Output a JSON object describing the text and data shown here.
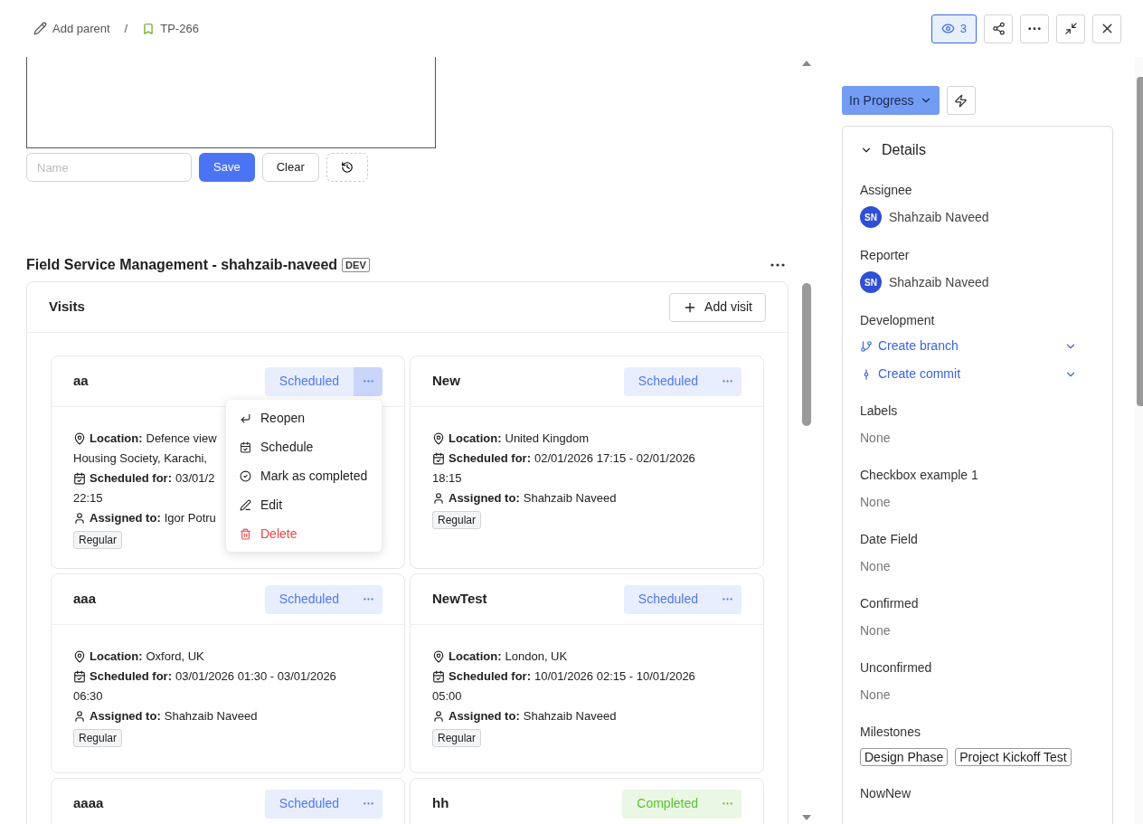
{
  "breadcrumb": {
    "parent_action": "Add parent",
    "separator": "/",
    "issue_key": "TP-266"
  },
  "header_actions": {
    "watchers": "3"
  },
  "editor": {
    "name_placeholder": "Name",
    "save": "Save",
    "clear": "Clear"
  },
  "section": {
    "title": "Field Service Management - shahzaib-naveed",
    "badge": "DEV"
  },
  "visits": {
    "title": "Visits",
    "add_button": "Add visit",
    "cards": [
      {
        "name": "aa",
        "status": "Scheduled",
        "color": "#4f78f0",
        "menu_open": true,
        "location_label": "Location:",
        "location": "Defence view",
        "location_cont": "Housing Society, Karachi,",
        "scheduled_label": "Scheduled for:",
        "scheduled": "03/01/2",
        "scheduled_cont": "22:15",
        "assigned_label": "Assigned to:",
        "assigned": "Igor Potru",
        "tag": "Regular"
      },
      {
        "name": "New",
        "status": "Scheduled",
        "color": "#4f78f0",
        "menu_open": false,
        "location_label": "Location:",
        "location": "United Kingdom",
        "scheduled_label": "Scheduled for:",
        "scheduled": "02/01/2026 17:15 - 02/01/2026",
        "scheduled_cont": "18:15",
        "assigned_label": "Assigned to:",
        "assigned": "Shahzaib Naveed",
        "tag": "Regular"
      },
      {
        "name": "aaa",
        "status": "Scheduled",
        "color": "#4f78f0",
        "menu_open": false,
        "location_label": "Location:",
        "location": "Oxford, UK",
        "scheduled_label": "Scheduled for:",
        "scheduled": "03/01/2026 01:30 - 03/01/2026",
        "scheduled_cont": "06:30",
        "assigned_label": "Assigned to:",
        "assigned": "Shahzaib Naveed",
        "tag": "Regular"
      },
      {
        "name": "NewTest",
        "status": "Scheduled",
        "color": "#4f78f0",
        "menu_open": false,
        "location_label": "Location:",
        "location": "London, UK",
        "scheduled_label": "Scheduled for:",
        "scheduled": "10/01/2026 02:15 - 10/01/2026",
        "scheduled_cont": "05:00",
        "assigned_label": "Assigned to:",
        "assigned": "Shahzaib Naveed",
        "tag": "Regular"
      },
      {
        "name": "aaaa",
        "status": "Scheduled",
        "color": "#4f78f0",
        "menu_open": false
      },
      {
        "name": "hh",
        "status": "Completed",
        "color": "#5cc232",
        "menu_open": false
      }
    ],
    "menu": [
      {
        "label": "Reopen",
        "kind": "reopen"
      },
      {
        "label": "Schedule",
        "kind": "schedule"
      },
      {
        "label": "Mark as completed",
        "kind": "complete"
      },
      {
        "label": "Edit",
        "kind": "edit"
      },
      {
        "label": "Delete",
        "kind": "delete"
      }
    ]
  },
  "sidebar": {
    "status": "In Progress",
    "details_title": "Details",
    "details_expanded": true,
    "fields": [
      {
        "label": "Assignee",
        "kind": "person",
        "initials": "SN",
        "value": "Shahzaib Naveed"
      },
      {
        "label": "Reporter",
        "kind": "person",
        "initials": "SN",
        "value": "Shahzaib Naveed"
      },
      {
        "label": "Development",
        "kind": "links",
        "links": [
          {
            "label": "Create branch",
            "kind": "branch"
          },
          {
            "label": "Create commit",
            "kind": "commit"
          }
        ]
      },
      {
        "label": "Labels",
        "kind": "text",
        "value": "None"
      },
      {
        "label": "Checkbox example 1",
        "kind": "text",
        "value": "None"
      },
      {
        "label": "Date Field",
        "kind": "text",
        "value": "None"
      },
      {
        "label": "Confirmed",
        "kind": "text",
        "value": "None"
      },
      {
        "label": "Unconfirmed",
        "kind": "text",
        "value": "None"
      },
      {
        "label": "Milestones",
        "kind": "tags",
        "tags": [
          "Design Phase",
          "Project Kickoff Test"
        ]
      },
      {
        "label": "NowNew",
        "kind": "heading"
      }
    ]
  }
}
